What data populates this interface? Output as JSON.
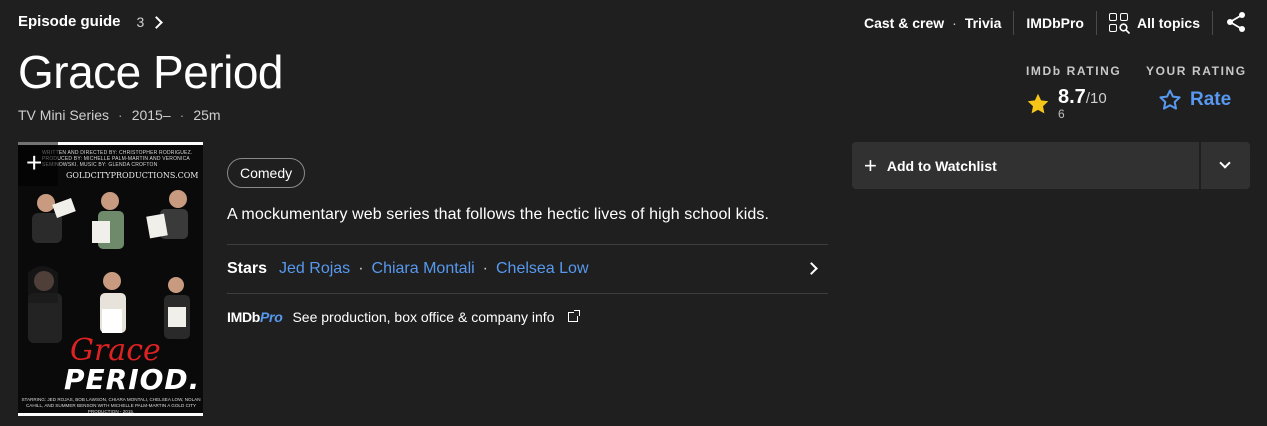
{
  "episode_guide": {
    "label": "Episode guide",
    "count": "3"
  },
  "topnav": {
    "cast_crew": "Cast & crew",
    "trivia": "Trivia",
    "imdbpro": "IMDbPro",
    "all_topics": "All topics",
    "icons": [
      "grid-search-icon",
      "share-icon"
    ]
  },
  "title": "Grace Period",
  "meta": {
    "type": "TV Mini Series",
    "years": "2015–",
    "sep": "·",
    "runtime": "25m"
  },
  "imdb_rating": {
    "label": "IMDb RATING",
    "score": "8.7",
    "out_of": "/10",
    "votes": "6"
  },
  "your_rating": {
    "label": "YOUR RATING",
    "action": "Rate"
  },
  "poster": {
    "credits": "Written and Directed by: Christopher Rodriguez. Produced by: Michelle Palm-Martin and Veronica Seminowski. Music by: Glenda Crofton",
    "url": "GOLDCITYPRODUCTIONS.COM",
    "title_line1": "Grace",
    "title_line2": "PERIOD.",
    "starring": "Starring: Jed Rojas, Bob Lawson, Chiara Montali, Chelsea Low, Nolan Cahill, and Summer Benson with Michelle Palm-Martin a Gold City Production - 2015."
  },
  "genres": [
    "Comedy"
  ],
  "plot": "A mockumentary web series that follows the hectic lives of high school kids.",
  "stars": {
    "label": "Stars",
    "names": [
      "Jed Rojas",
      "Chiara Montali",
      "Chelsea Low"
    ]
  },
  "imdbpro_row": {
    "logo_main": "IMDb",
    "logo_pro": "Pro",
    "text": "See production, box office & company info"
  },
  "watchlist": {
    "label": "Add to Watchlist"
  },
  "colors": {
    "background": "#1f1f1f",
    "accent_link": "#5799ef",
    "star_yellow": "#f5c518",
    "button_bg": "#313131"
  }
}
